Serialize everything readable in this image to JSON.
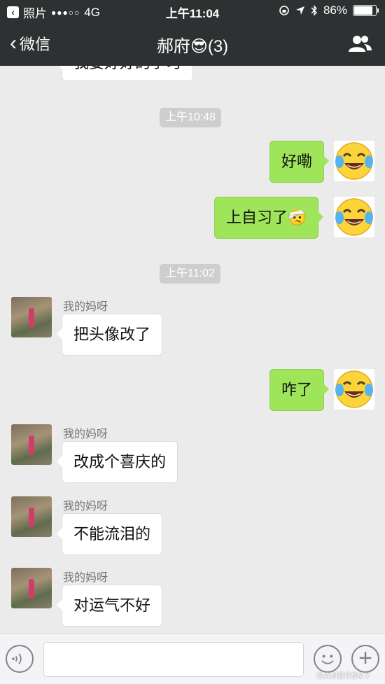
{
  "status_bar": {
    "back_app": "照片",
    "signal_dots": "●●●○○",
    "network": "4G",
    "time": "上午11:04",
    "battery": "86%",
    "battery_level": 0.86
  },
  "nav": {
    "back_label": "微信",
    "title": "郝府",
    "title_emoji": "😎",
    "member_count": "(3)"
  },
  "chat": {
    "partial_top": "我要好好的学习",
    "timestamps": [
      "上午10:48",
      "上午11:02"
    ],
    "out_messages": [
      "好嘞",
      "上自习了",
      "咋了"
    ],
    "out_emoji_inline": "🤕",
    "sender_name": "我的妈呀",
    "in_messages": [
      "把头像改了",
      "改成个喜庆的",
      "不能流泪的",
      "对运气不好"
    ]
  },
  "watermark": "GAMERSKY",
  "colors": {
    "topbar": "#2e3132",
    "background": "#ebebeb",
    "out_bubble": "#9fe55a",
    "in_bubble": "#ffffff"
  },
  "icons": {
    "self_avatar": "tears-of-joy-emoji-icon",
    "contacts": "people-icon"
  }
}
